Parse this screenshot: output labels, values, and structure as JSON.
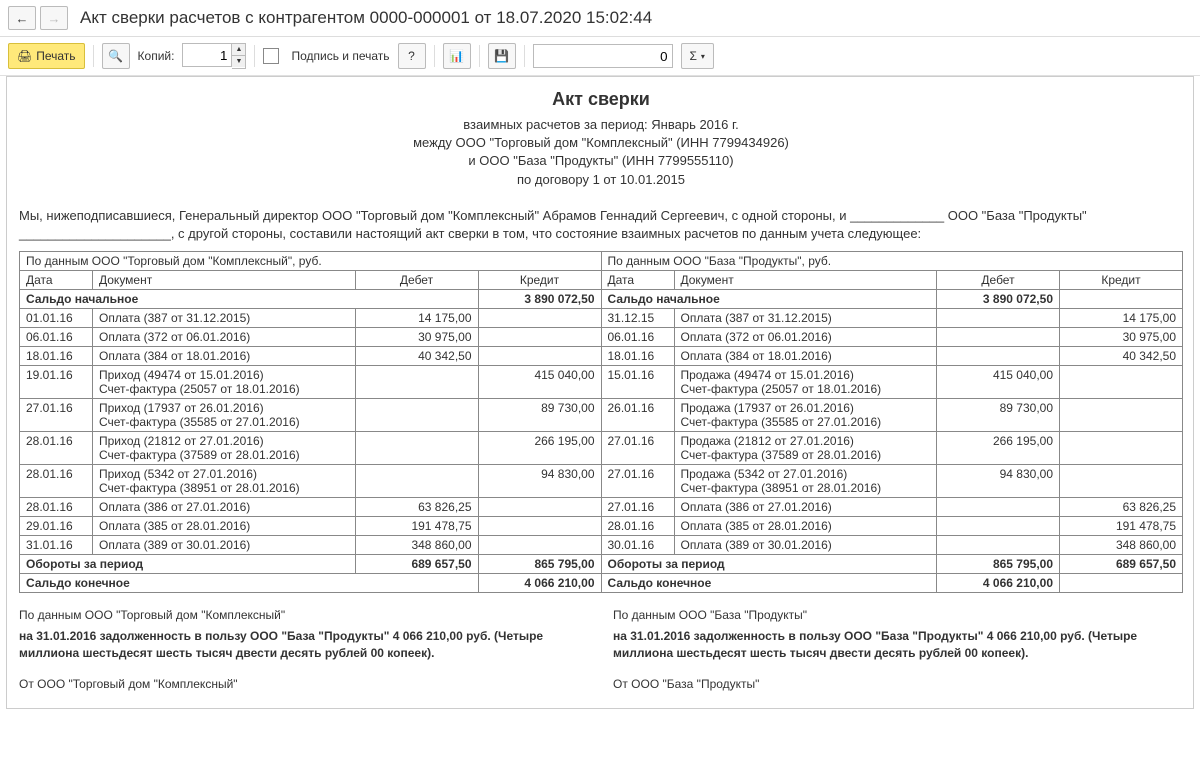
{
  "title": "Акт сверки расчетов с контрагентом 0000-000001 от 18.07.2020 15:02:44",
  "toolbar": {
    "print": "Печать",
    "copies_label": "Копий:",
    "copies_value": "1",
    "sign_print": "Подпись и печать",
    "help": "?",
    "zero_value": "0",
    "sigma": "Σ"
  },
  "doc": {
    "h1": "Акт сверки",
    "sub1": "взаимных расчетов за период: Январь 2016 г.",
    "sub2": "между ООО \"Торговый дом \"Комплексный\" (ИНН 7799434926)",
    "sub3": "и ООО \"База \"Продукты\" (ИНН 7799555110)",
    "sub4": "по договору 1 от 10.01.2015",
    "intro": "Мы, нижеподписавшиеся, Генеральный директор ООО \"Торговый дом \"Комплексный\" Абрамов Геннадий Сергеевич, с одной стороны, и _____________ ООО \"База \"Продукты\" _____________________, с другой стороны, составили настоящий акт сверки в том, что состояние взаимных расчетов по данным учета следующее:"
  },
  "table": {
    "left_header": "По данным ООО \"Торговый дом \"Комплексный\", руб.",
    "right_header": "По данным ООО \"База \"Продукты\", руб.",
    "col_date": "Дата",
    "col_doc": "Документ",
    "col_debit": "Дебет",
    "col_credit": "Кредит",
    "row_saldo_start": "Сальдо начальное",
    "row_turnover": "Обороты за период",
    "row_saldo_end": "Сальдо конечное",
    "left_saldo_start_credit": "3 890 072,50",
    "right_saldo_start_debit": "3 890 072,50",
    "rows": [
      {
        "l_date": "01.01.16",
        "l_doc": "Оплата (387 от 31.12.2015)",
        "l_deb": "14 175,00",
        "l_cre": "",
        "r_date": "31.12.15",
        "r_doc": "Оплата (387 от 31.12.2015)",
        "r_deb": "",
        "r_cre": "14 175,00"
      },
      {
        "l_date": "06.01.16",
        "l_doc": "Оплата (372 от 06.01.2016)",
        "l_deb": "30 975,00",
        "l_cre": "",
        "r_date": "06.01.16",
        "r_doc": "Оплата (372 от 06.01.2016)",
        "r_deb": "",
        "r_cre": "30 975,00"
      },
      {
        "l_date": "18.01.16",
        "l_doc": "Оплата (384 от 18.01.2016)",
        "l_deb": "40 342,50",
        "l_cre": "",
        "r_date": "18.01.16",
        "r_doc": "Оплата (384 от 18.01.2016)",
        "r_deb": "",
        "r_cre": "40 342,50"
      },
      {
        "l_date": "19.01.16",
        "l_doc": "Приход (49474 от 15.01.2016)\nСчет-фактура (25057 от 18.01.2016)",
        "l_deb": "",
        "l_cre": "415 040,00",
        "r_date": "15.01.16",
        "r_doc": "Продажа (49474 от 15.01.2016)\nСчет-фактура (25057 от 18.01.2016)",
        "r_deb": "415 040,00",
        "r_cre": ""
      },
      {
        "l_date": "27.01.16",
        "l_doc": "Приход (17937 от 26.01.2016)\nСчет-фактура (35585 от 27.01.2016)",
        "l_deb": "",
        "l_cre": "89 730,00",
        "r_date": "26.01.16",
        "r_doc": "Продажа (17937 от 26.01.2016)\nСчет-фактура (35585 от 27.01.2016)",
        "r_deb": "89 730,00",
        "r_cre": ""
      },
      {
        "l_date": "28.01.16",
        "l_doc": "Приход (21812 от 27.01.2016)\nСчет-фактура (37589 от 28.01.2016)",
        "l_deb": "",
        "l_cre": "266 195,00",
        "r_date": "27.01.16",
        "r_doc": "Продажа (21812 от 27.01.2016)\nСчет-фактура (37589 от 28.01.2016)",
        "r_deb": "266 195,00",
        "r_cre": ""
      },
      {
        "l_date": "28.01.16",
        "l_doc": "Приход (5342 от 27.01.2016)\nСчет-фактура (38951 от 28.01.2016)",
        "l_deb": "",
        "l_cre": "94 830,00",
        "r_date": "27.01.16",
        "r_doc": "Продажа (5342 от 27.01.2016)\nСчет-фактура (38951 от 28.01.2016)",
        "r_deb": "94 830,00",
        "r_cre": ""
      },
      {
        "l_date": "28.01.16",
        "l_doc": "Оплата (386 от 27.01.2016)",
        "l_deb": "63 826,25",
        "l_cre": "",
        "r_date": "27.01.16",
        "r_doc": "Оплата (386 от 27.01.2016)",
        "r_deb": "",
        "r_cre": "63 826,25"
      },
      {
        "l_date": "29.01.16",
        "l_doc": "Оплата (385 от 28.01.2016)",
        "l_deb": "191 478,75",
        "l_cre": "",
        "r_date": "28.01.16",
        "r_doc": "Оплата (385 от 28.01.2016)",
        "r_deb": "",
        "r_cre": "191 478,75"
      },
      {
        "l_date": "31.01.16",
        "l_doc": "Оплата (389 от 30.01.2016)",
        "l_deb": "348 860,00",
        "l_cre": "",
        "r_date": "30.01.16",
        "r_doc": "Оплата (389 от 30.01.2016)",
        "r_deb": "",
        "r_cre": "348 860,00"
      }
    ],
    "left_turn_deb": "689 657,50",
    "left_turn_cre": "865 795,00",
    "right_turn_deb": "865 795,00",
    "right_turn_cre": "689 657,50",
    "left_saldo_end_cre": "4 066 210,00",
    "right_saldo_end_deb": "4 066 210,00"
  },
  "footer": {
    "left_hdr": "По данным ООО \"Торговый дом \"Комплексный\"",
    "left_body": "на 31.01.2016 задолженность в пользу ООО \"База \"Продукты\" 4 066 210,00 руб. (Четыре миллиона шестьдесят шесть тысяч двести десять рублей 00 копеек).",
    "left_from": "От ООО \"Торговый дом \"Комплексный\"",
    "right_hdr": "По данным ООО \"База \"Продукты\"",
    "right_body": "на 31.01.2016 задолженность в пользу ООО \"База \"Продукты\" 4 066 210,00 руб. (Четыре миллиона шестьдесят шесть тысяч двести десять рублей 00 копеек).",
    "right_from": "От ООО \"База \"Продукты\""
  }
}
